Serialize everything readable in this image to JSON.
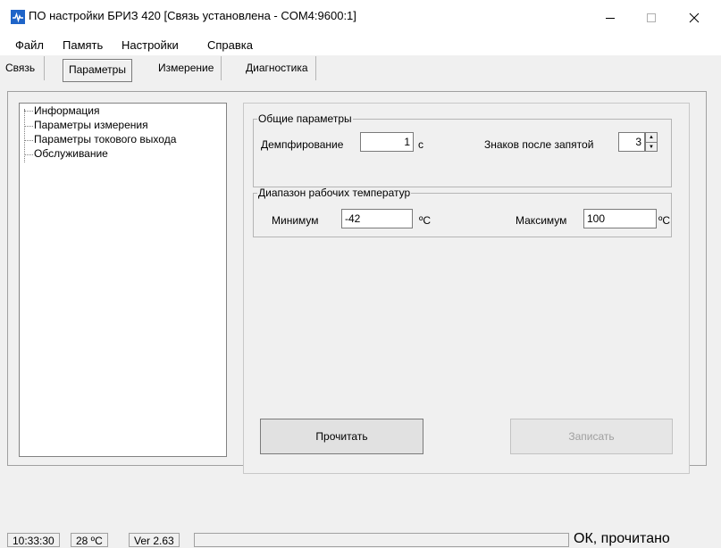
{
  "window": {
    "title": "ПО настройки БРИЗ 420 [Связь установлена - COM4:9600:1]",
    "icon": "app-logo-icon",
    "accent_color": "#1e64c8"
  },
  "menu": {
    "items": [
      {
        "label": "Файл"
      },
      {
        "label": "Память"
      },
      {
        "label": "Настройки"
      },
      {
        "label": "Справка"
      }
    ]
  },
  "tabs": [
    {
      "label": "Связь"
    },
    {
      "label": "Параметры",
      "selected": true
    },
    {
      "label": "Измерение"
    },
    {
      "label": "Диагностика"
    }
  ],
  "tree": {
    "items": [
      {
        "label": "Информация"
      },
      {
        "label": "Параметры измерения"
      },
      {
        "label": "Параметры токового выхода"
      },
      {
        "label": "Обслуживание"
      }
    ]
  },
  "general": {
    "legend": "Общие параметры",
    "damping_label": "Демпфирование",
    "damping_value": "1",
    "damping_unit": "с",
    "decimals_label": "Знаков после запятой",
    "decimals_value": "3"
  },
  "temp": {
    "legend": "Диапазон рабочих температур",
    "min_label": "Минимум",
    "min_value": "-42",
    "min_unit": "ºС",
    "max_label": "Максимум",
    "max_value": "100",
    "max_unit": "ºС"
  },
  "buttons": {
    "read": "Прочитать",
    "write": "Записать"
  },
  "status": {
    "time": "10:33:30",
    "temperature": "28 ºС",
    "version": "Ver 2.63",
    "message": "ОК, прочитано"
  }
}
